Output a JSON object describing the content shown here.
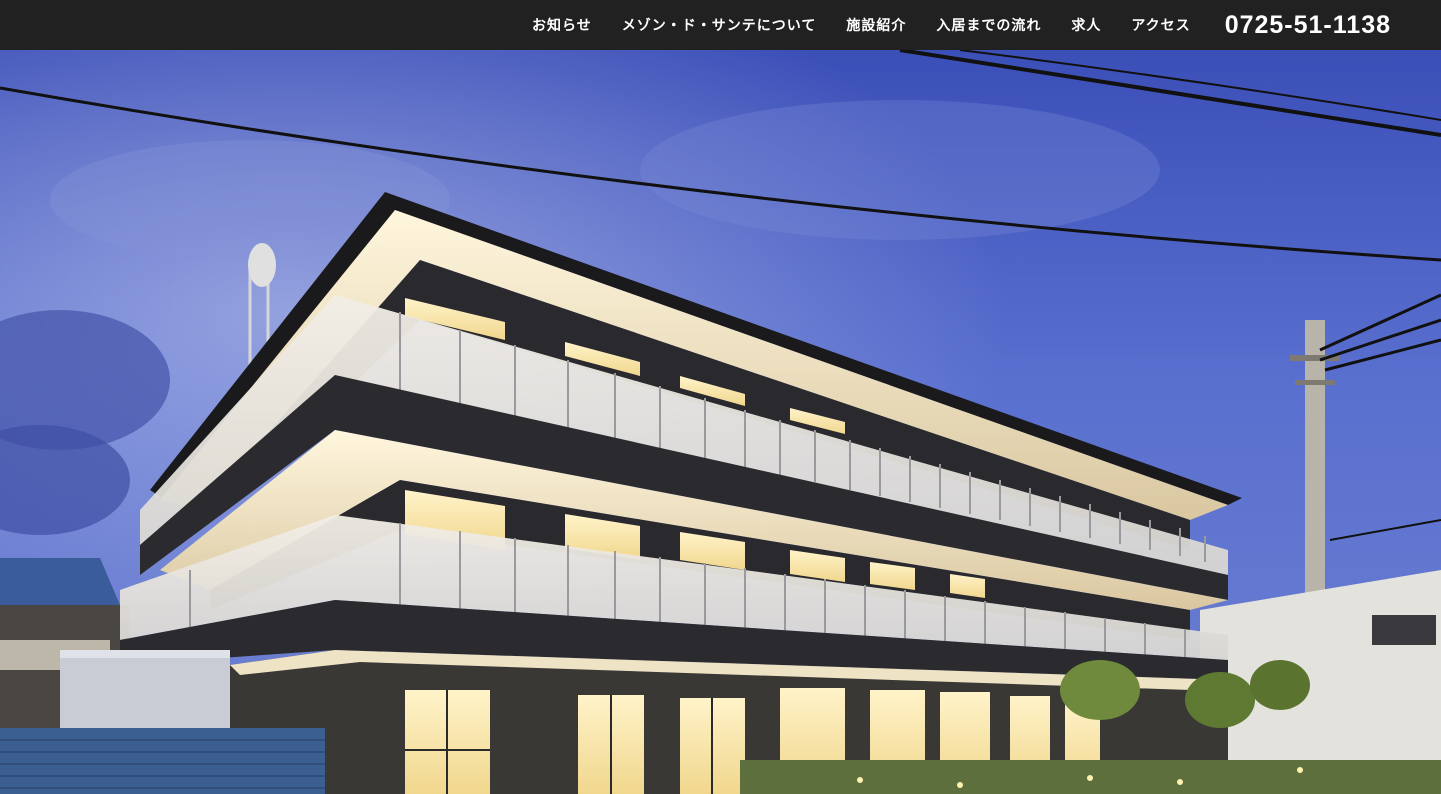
{
  "nav": {
    "items": [
      {
        "label": "お知らせ",
        "name": "nav-news"
      },
      {
        "label": "メゾン・ド・サンテについて",
        "name": "nav-about"
      },
      {
        "label": "施設紹介",
        "name": "nav-facility"
      },
      {
        "label": "入居までの流れ",
        "name": "nav-flow"
      },
      {
        "label": "求人",
        "name": "nav-recruit"
      },
      {
        "label": "アクセス",
        "name": "nav-access"
      }
    ],
    "phone": "0725-51-1138"
  },
  "hero": {
    "image": "building-exterior-photo"
  }
}
